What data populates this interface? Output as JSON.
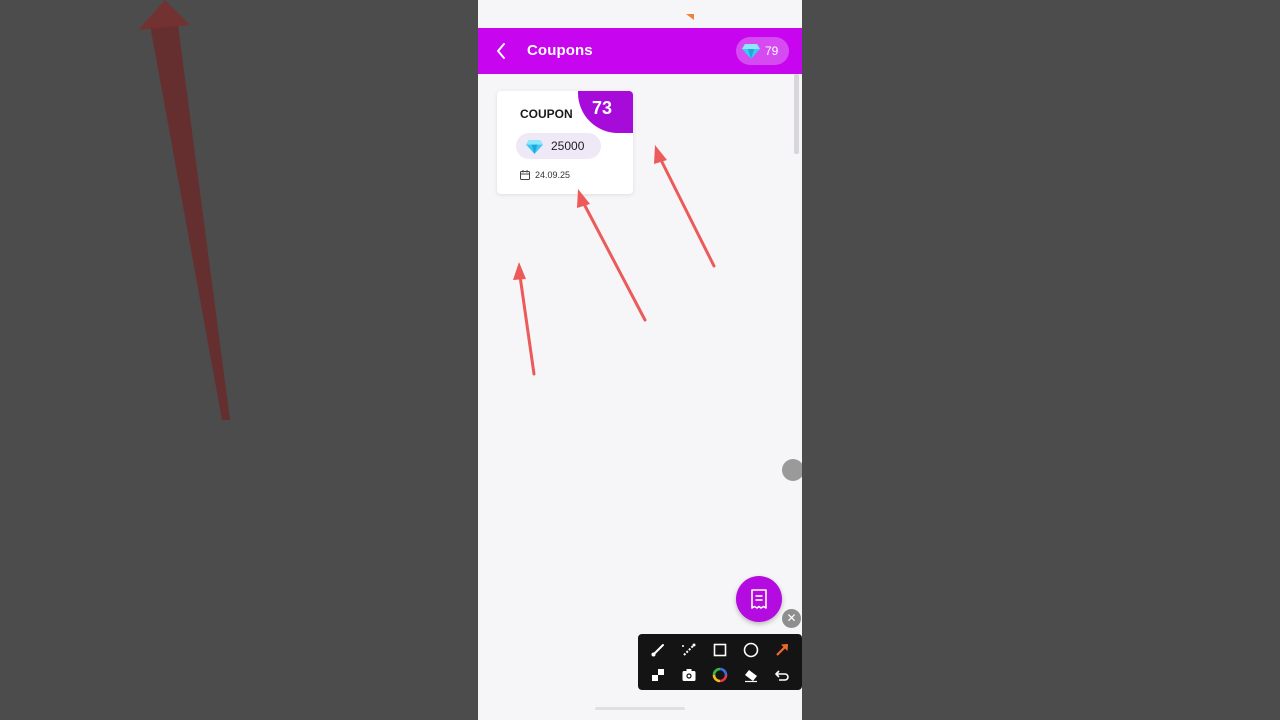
{
  "app_bar": {
    "title": "Coupons",
    "gem_count": "79"
  },
  "coupons": [
    {
      "title": "COUPON",
      "number": "73",
      "price": "25000",
      "date": "24.09.25"
    }
  ],
  "colors": {
    "primary": "#c705ee",
    "badge": "#a70bd9",
    "fab": "#b40be0",
    "annotation": "#ec5a5a"
  },
  "toolbar": {
    "tools": [
      "brush-icon",
      "magic-brush-icon",
      "rectangle-icon",
      "circle-icon",
      "arrow-icon",
      "mosaic-icon",
      "camera-icon",
      "color-picker-icon",
      "eraser-icon",
      "undo-icon"
    ]
  },
  "close_symbol": "✕"
}
